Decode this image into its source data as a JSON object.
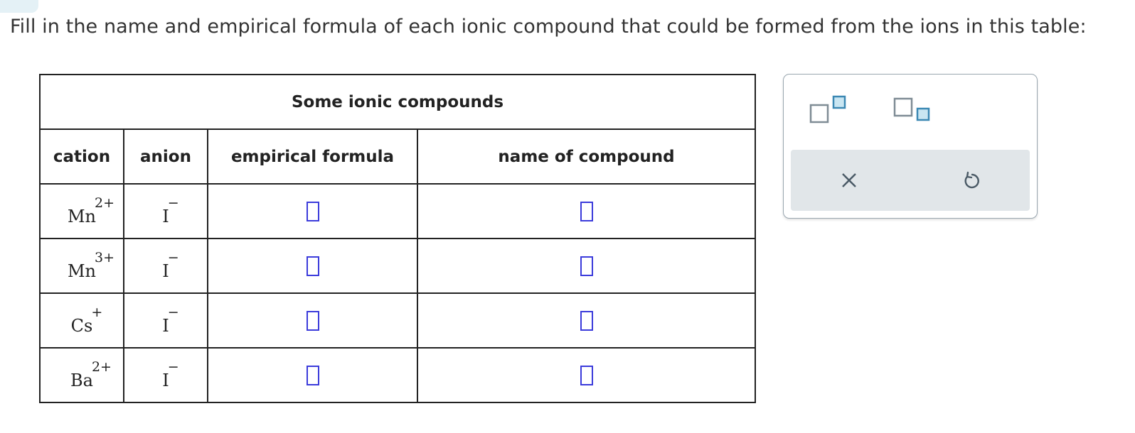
{
  "instruction": "Fill in the name and empirical formula of each ionic compound that could be formed from the ions in this table:",
  "table": {
    "caption": "Some ionic compounds",
    "headers": {
      "cation": "cation",
      "anion": "anion",
      "formula": "empirical formula",
      "name": "name of compound"
    },
    "rows": [
      {
        "cation": "Mn",
        "cation_charge": "2+",
        "anion": "I",
        "anion_charge": "−",
        "formula": "",
        "name": ""
      },
      {
        "cation": "Mn",
        "cation_charge": "3+",
        "anion": "I",
        "anion_charge": "−",
        "formula": "",
        "name": ""
      },
      {
        "cation": "Cs",
        "cation_charge": "+",
        "anion": "I",
        "anion_charge": "−",
        "formula": "",
        "name": ""
      },
      {
        "cation": "Ba",
        "cation_charge": "2+",
        "anion": "I",
        "anion_charge": "−",
        "formula": "",
        "name": ""
      }
    ]
  },
  "palette": {
    "superscript_icon": "superscript-template-icon",
    "subscript_icon": "subscript-template-icon",
    "clear_icon": "close-icon",
    "undo_icon": "undo-icon"
  },
  "colors": {
    "answer_box_border": "#3b3bdb",
    "palette_square_stroke": "#7f8c95",
    "palette_square_fill": "#c9e6f2",
    "palette_square_accent": "#3b88b3",
    "palette_bottom_bg": "#e1e6e9"
  }
}
